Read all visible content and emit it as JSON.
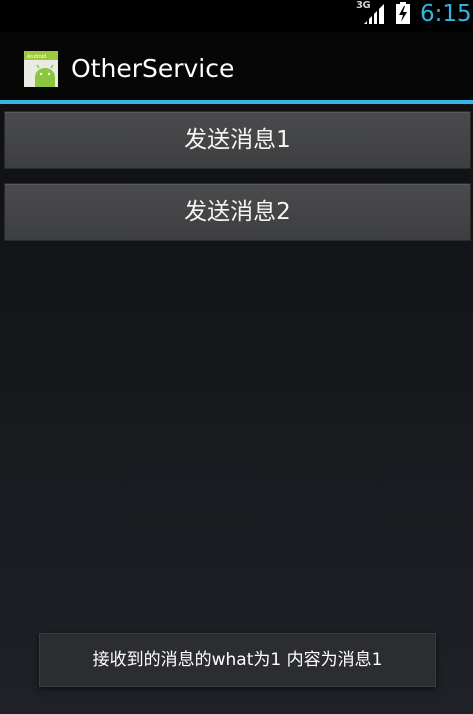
{
  "status_bar": {
    "network_type": "3G",
    "signal_icon": "signal-bars-icon",
    "battery_icon": "battery-charging-icon",
    "time": "6:15",
    "accent_color": "#33b5e5"
  },
  "action_bar": {
    "app_icon": "android-app-icon",
    "title": "OtherService",
    "divider_color": "#33b5e5"
  },
  "buttons": [
    {
      "label": "发送消息1"
    },
    {
      "label": "发送消息2"
    }
  ],
  "toast": {
    "message": "接收到的消息的what为1 内容为消息1"
  }
}
